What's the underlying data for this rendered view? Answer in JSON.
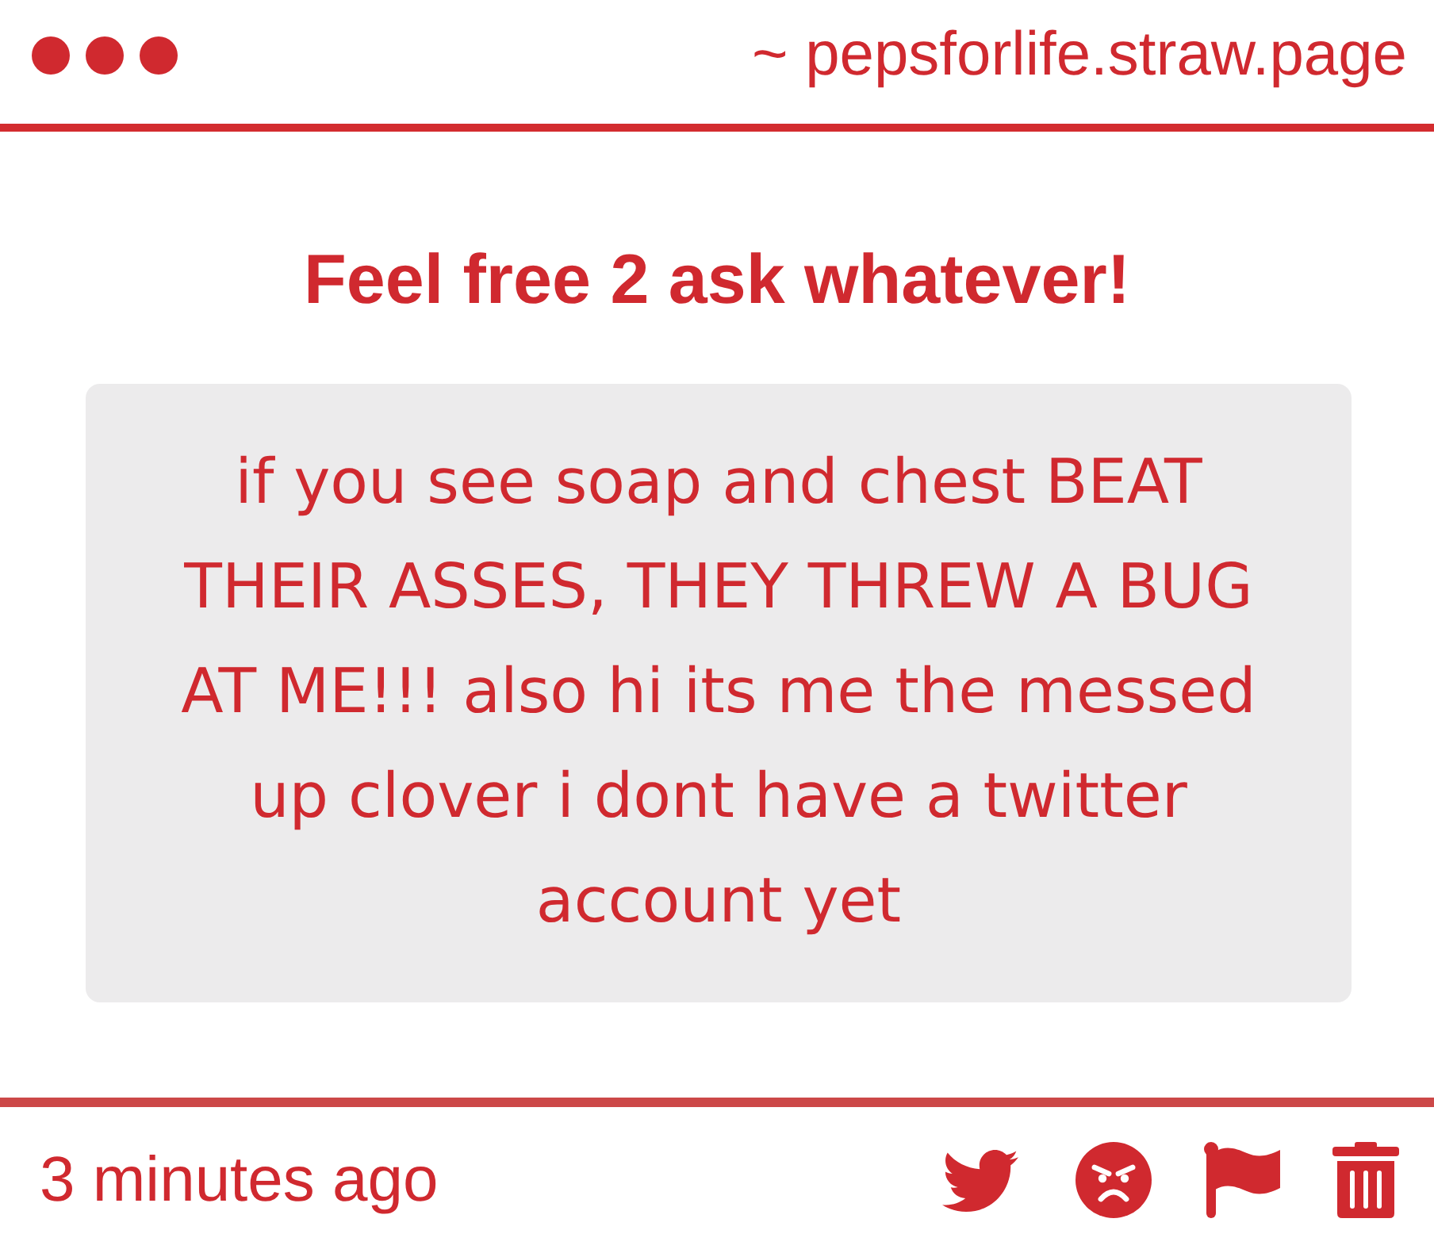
{
  "header": {
    "url": "~ pepsforlife.straw.page"
  },
  "prompt": {
    "title": "Feel free 2 ask whatever!"
  },
  "message": {
    "text": "if you see soap and chest BEAT THEIR ASSES, THEY THREW A BUG AT ME!!! also hi its me the messed up clover i dont have a twitter account yet"
  },
  "footer": {
    "time": "3 minutes ago"
  }
}
